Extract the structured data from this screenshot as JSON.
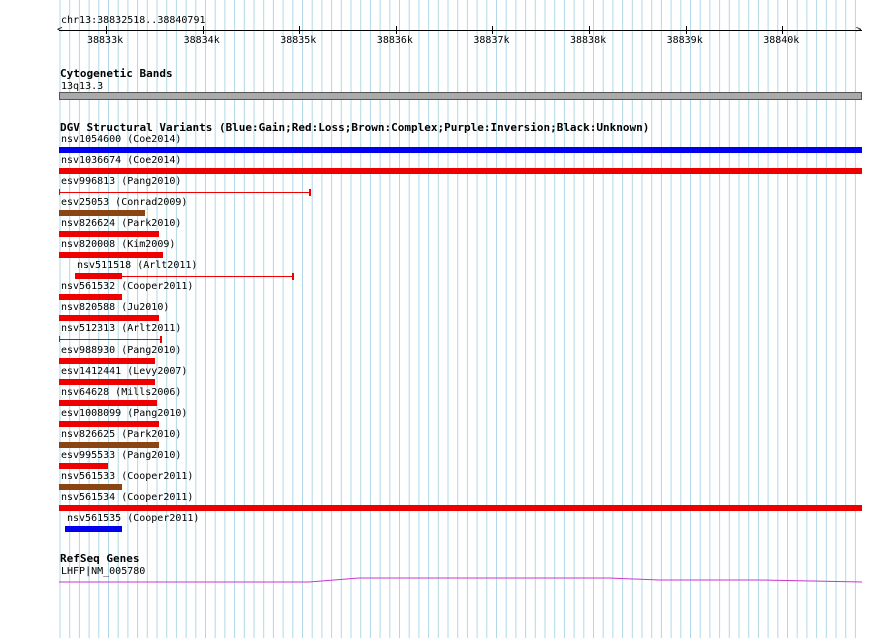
{
  "ruler": {
    "position": "chr13:38832518..38840791",
    "ticks": [
      "38833k",
      "38834k",
      "38835k",
      "38836k",
      "38837k",
      "38838k",
      "38839k",
      "38840k"
    ]
  },
  "cytoband": {
    "title": "Cytogenetic Bands",
    "band": "13q13.3"
  },
  "dgv": {
    "title": "DGV Structural Variants (Blue:Gain;Red:Loss;Brown:Complex;Purple:Inversion;Black:Unknown)",
    "variants": [
      {
        "label": "nsv1054600 (Coe2014)",
        "color": "#0000ee"
      },
      {
        "label": "nsv1036674 (Coe2014)",
        "color": "#ee0000"
      },
      {
        "label": "esv996813 (Pang2010)",
        "color": "#ee0000"
      },
      {
        "label": "esv25053 (Conrad2009)",
        "color": "#8b4513"
      },
      {
        "label": "nsv826624 (Park2010)",
        "color": "#ee0000"
      },
      {
        "label": "nsv820008 (Kim2009)",
        "color": "#ee0000"
      },
      {
        "label": "nsv511518 (Arlt2011)",
        "color": "#ee0000"
      },
      {
        "label": "nsv561532 (Cooper2011)",
        "color": "#ee0000"
      },
      {
        "label": "nsv820588 (Ju2010)",
        "color": "#ee0000"
      },
      {
        "label": "nsv512313 (Arlt2011)",
        "color": "#ee0000"
      },
      {
        "label": "esv988930 (Pang2010)",
        "color": "#ee0000"
      },
      {
        "label": "esv1412441 (Levy2007)",
        "color": "#ee0000"
      },
      {
        "label": "nsv64628 (Mills2006)",
        "color": "#ee0000"
      },
      {
        "label": "esv1008099 (Pang2010)",
        "color": "#ee0000"
      },
      {
        "label": "nsv826625 (Park2010)",
        "color": "#8b4513"
      },
      {
        "label": "esv995533 (Pang2010)",
        "color": "#ee0000"
      },
      {
        "label": "nsv561533 (Cooper2011)",
        "color": "#8b4513"
      },
      {
        "label": "nsv561534 (Cooper2011)",
        "color": "#ee0000"
      },
      {
        "label": "nsv561535 (Cooper2011)",
        "color": "#0000ee"
      }
    ]
  },
  "refseq": {
    "title": "RefSeq Genes",
    "gene": "LHFP|NM_005780",
    "color": "#cc33cc"
  },
  "colors": {
    "grid": "#b0d8e8",
    "cytoband_fill": "#aaaaaa"
  }
}
